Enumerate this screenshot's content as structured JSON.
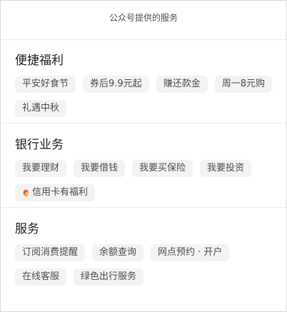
{
  "header": {
    "title": "公众号提供的服务"
  },
  "sections": [
    {
      "title": "便捷福利",
      "items": [
        "平安好食节",
        "券后9.9元起",
        "赚还款金",
        "周一8元购",
        "礼遇中秋"
      ]
    },
    {
      "title": "银行业务",
      "items": [
        "我要理财",
        "我要借钱",
        "我要买保险",
        "我要投资",
        "信用卡有福利"
      ]
    },
    {
      "title": "服务",
      "items": [
        "订阅消费提醒",
        "余额查询",
        "网点预约 · 开户",
        "在线客服",
        "绿色出行服务"
      ]
    }
  ],
  "icons": {
    "credit_card_item_icon": "fire-icon"
  },
  "colors": {
    "chip_bg": "#f2f3f5",
    "chip_text": "#4d4d4d",
    "title_text": "#1f1f1f",
    "header_text": "#4f4f4f",
    "flame_outer": "#f25a1a",
    "flame_inner": "#ffb11a"
  }
}
